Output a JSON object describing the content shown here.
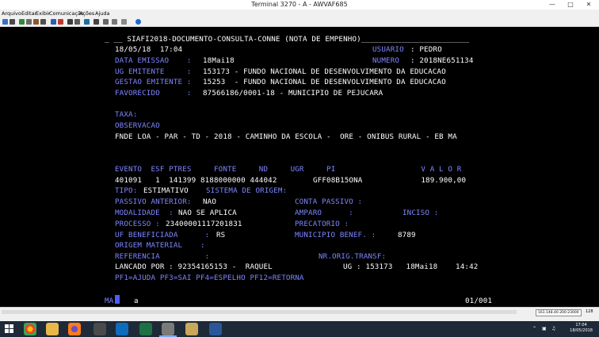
{
  "window": {
    "title": "Terminal 3270 - A - AWVAF685"
  },
  "menu": [
    "Arquivo",
    "Editar",
    "Exibir",
    "Comunicação",
    "Ações",
    "Ajuda"
  ],
  "terminal": {
    "header": "_ __ SIAFI2018-DOCUMENTO-CONSULTA-CONNE (NOTA DE EMPENHO)________________________",
    "datetime": "18/05/18  17:04",
    "usuario_label": "USUARIO",
    "usuario_value": ": PEDRO",
    "data_emissao_label": "DATA EMISSAO    :",
    "data_emissao_value": "18Mai18",
    "numero_label": "NUMERO",
    "numero_value": ": 2018NE651134",
    "ug_emitente_label": "UG EMITENTE     :",
    "ug_emitente_value": "153173 - FUNDO NACIONAL DE DESENVOLVIMENTO DA EDUCACAO",
    "gestao_label": "GESTAO EMITENTE :",
    "gestao_value": "15253  - FUNDO NACIONAL DE DESENVOLVIMENTO DA EDUCACAO",
    "favorecido_label": "FAVORECIDO      :",
    "favorecido_value": "87566186/0001-18 - MUNICIPIO DE PEJUCARA",
    "taxa_label": "TAXA:",
    "observacao_label": "OBSERVACAO",
    "observacao_text": "FNDE LOA - PAR - TD - 2018 - CAMINHO DA ESCOLA -  ORE - ONIBUS RURAL - EB MA",
    "table_header": "EVENTO  ESF PTRES     FONTE     ND     UGR     PI                   V A L O R",
    "table_row": "401091   1  141399 8188000000 444042        GFF08B15ONA             189.900,00",
    "tipo_label": "TIPO:",
    "tipo_value": "ESTIMATIVO",
    "sistema_label": "SISTEMA DE ORIGEM:",
    "passivo_label": "PASSIVO ANTERIOR:",
    "passivo_value": "NAO",
    "conta_passivo_label": "CONTA PASSIVO :",
    "modalidade_label": "MODALIDADE  :",
    "modalidade_value": "NAO SE APLICA",
    "amparo_label": "AMPARO      :",
    "inciso_label": "INCISO :",
    "processo_label": "PROCESSO :",
    "processo_value": "23400001117201831",
    "precatorio_label": "PRECATORIO :",
    "uf_label": "UF BENEFICIADA      :",
    "uf_value": "RS",
    "municipio_label": "MUNICIPIO BENEF. :",
    "municipio_value": "8789",
    "origem_label": "ORIGEM MATERIAL    :",
    "referencia_label": "REFERENCIA          :",
    "nr_orig_label": "NR.ORIG.TRANSF:",
    "lancado_text": "LANCADO POR : 92354165153 -  RAQUEL",
    "lancado_ug": "UG : 153173   18Mai18    14:42",
    "function_keys": "PF1=AJUDA PF3=SAI PF4=ESPELHO PF12=RETORNA",
    "command_prefix": "MA",
    "command_text": "a",
    "page_indicator": "01/001"
  },
  "status": {
    "ip": "161.148.40.200:23000",
    "count": "128"
  },
  "taskbar": {
    "time": "17:04",
    "date": "18/05/2018"
  },
  "colors": {
    "field_label": "#7f86ff",
    "field_value": "#ffffff",
    "background": "#000000"
  }
}
